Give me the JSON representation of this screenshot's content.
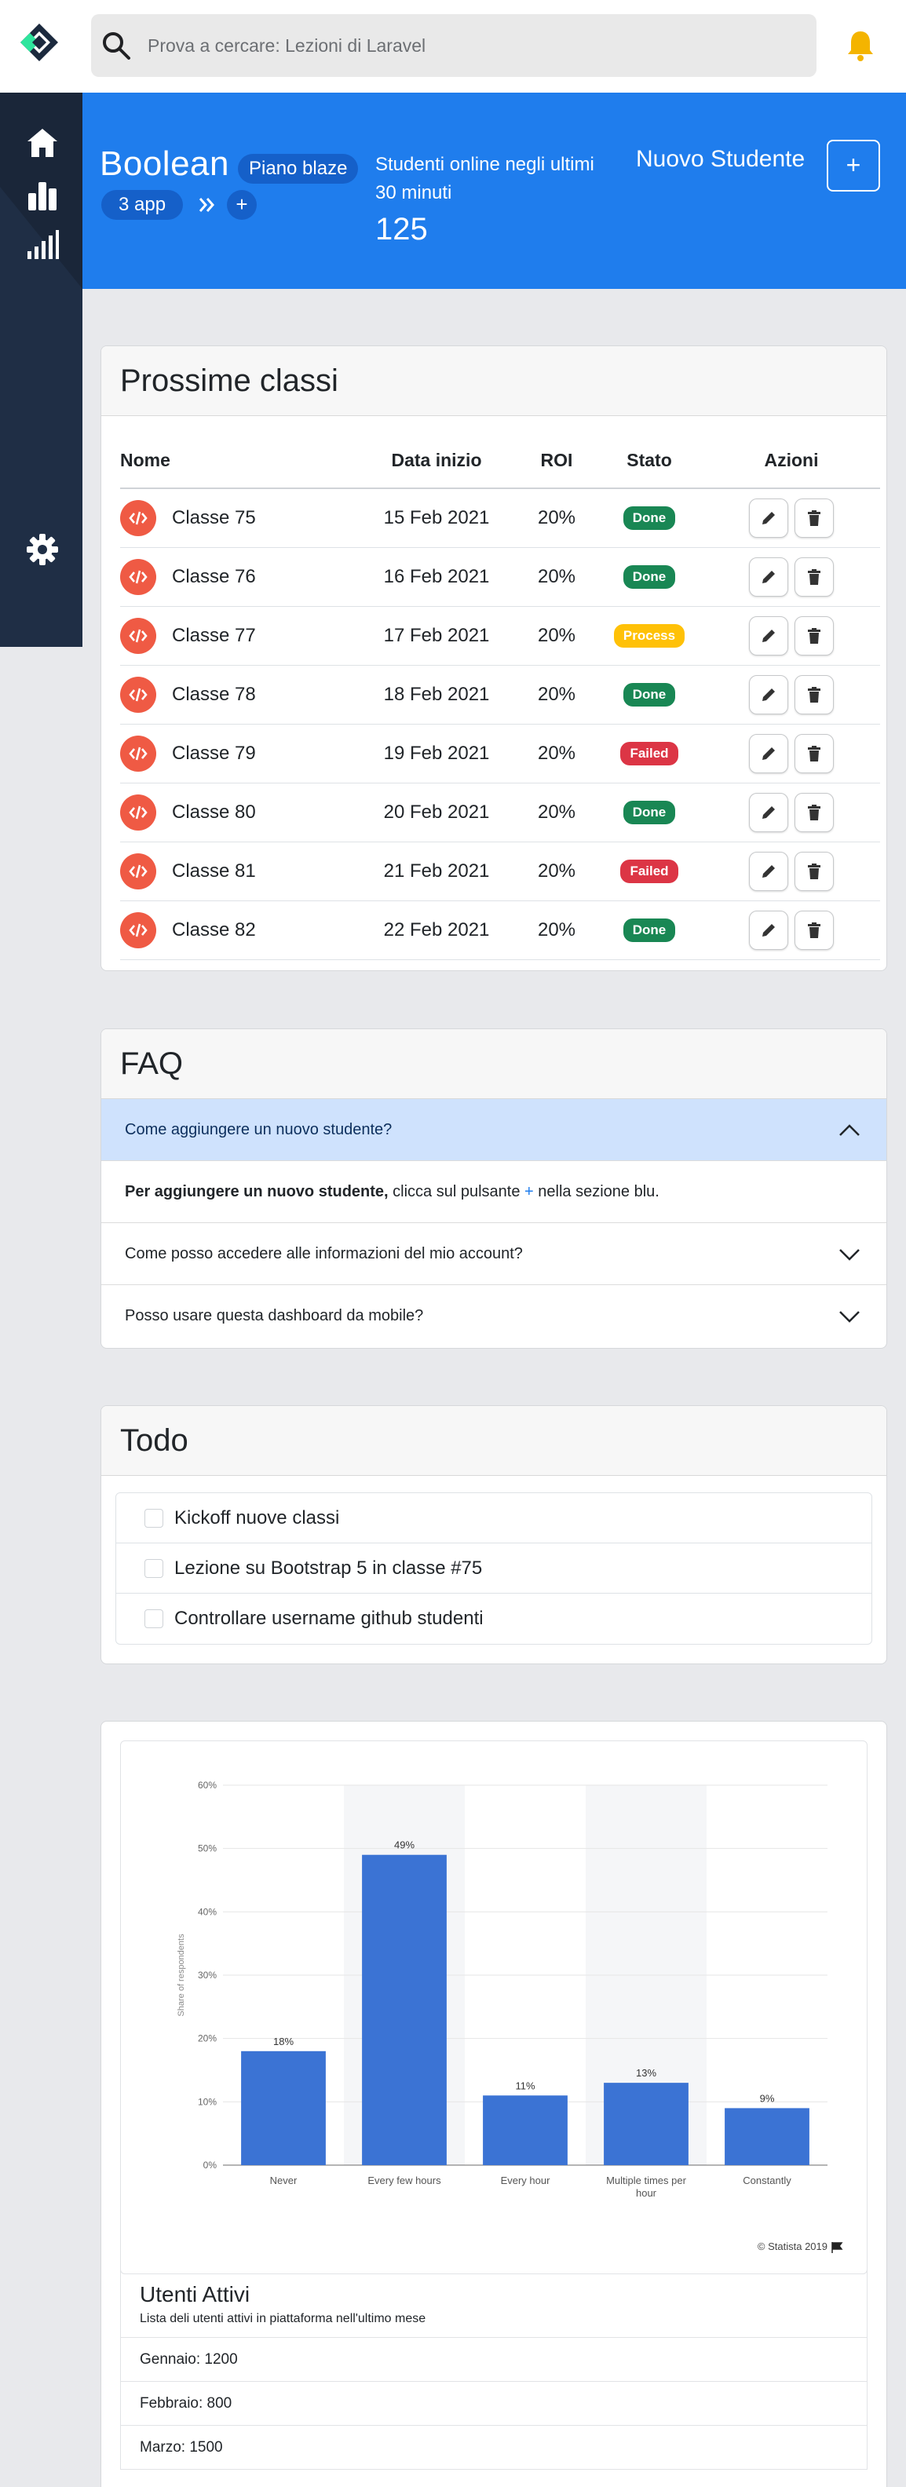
{
  "topbar": {
    "search_placeholder": "Prova a cercare: Lezioni di Laravel"
  },
  "hero": {
    "brand": "Boolean",
    "plan": "Piano blaze",
    "apps": "3 app",
    "online_label": "Studenti online negli ultimi 30 minuti",
    "online_count": "125",
    "new_student_label": "Nuovo Studente",
    "add_label": "+"
  },
  "classes": {
    "title": "Prossime classi",
    "headers": {
      "name": "Nome",
      "date": "Data inizio",
      "roi": "ROI",
      "status": "Stato",
      "actions": "Azioni"
    },
    "rows": [
      {
        "name": "Classe 75",
        "date": "15 Feb 2021",
        "roi": "20%",
        "status": "Done"
      },
      {
        "name": "Classe 76",
        "date": "16 Feb 2021",
        "roi": "20%",
        "status": "Done"
      },
      {
        "name": "Classe 77",
        "date": "17 Feb 2021",
        "roi": "20%",
        "status": "Process"
      },
      {
        "name": "Classe 78",
        "date": "18 Feb 2021",
        "roi": "20%",
        "status": "Done"
      },
      {
        "name": "Classe 79",
        "date": "19 Feb 2021",
        "roi": "20%",
        "status": "Failed"
      },
      {
        "name": "Classe 80",
        "date": "20 Feb 2021",
        "roi": "20%",
        "status": "Done"
      },
      {
        "name": "Classe 81",
        "date": "21 Feb 2021",
        "roi": "20%",
        "status": "Failed"
      },
      {
        "name": "Classe 82",
        "date": "22 Feb 2021",
        "roi": "20%",
        "status": "Done"
      }
    ],
    "status_colors": {
      "Done": "#198754",
      "Process": "#ffc107",
      "Failed": "#dc3545"
    }
  },
  "faq": {
    "title": "FAQ",
    "items": [
      {
        "question": "Come aggiungere un nuovo studente?"
      },
      {
        "question": "Come posso accedere alle informazioni del mio account?"
      },
      {
        "question": "Posso usare questa dashboard da mobile?"
      }
    ],
    "answer_bold": "Per aggiungere un nuovo studente,",
    "answer_text": " clicca sul pulsante ",
    "answer_plus": "+",
    "answer_end": " nella sezione blu."
  },
  "todo": {
    "title": "Todo",
    "items": [
      "Kickoff nuove classi",
      "Lezione su Bootstrap 5 in classe #75",
      "Controllare username github studenti"
    ]
  },
  "chart_data": {
    "type": "bar",
    "categories": [
      "Never",
      "Every few hours",
      "Every hour",
      "Multiple times per hour",
      "Constantly"
    ],
    "values": [
      18,
      49,
      11,
      13,
      9
    ],
    "value_labels": [
      "18%",
      "49%",
      "11%",
      "13%",
      "9%"
    ],
    "ylabel": "Share of respondents",
    "yticks": [
      "0%",
      "10%",
      "20%",
      "30%",
      "40%",
      "50%",
      "60%"
    ],
    "ylim": [
      0,
      60
    ],
    "highlighted_categories": [
      "Every few hours",
      "Multiple times per hour"
    ],
    "source": "© Statista 2019",
    "bar_color": "#3b73d4"
  },
  "users": {
    "title": "Utenti Attivi",
    "subtitle": "Lista deli utenti attivi in piattaforma nell'ultimo mese",
    "rows": [
      "Gennaio: 1200",
      "Febbraio: 800",
      "Marzo: 1500"
    ]
  }
}
